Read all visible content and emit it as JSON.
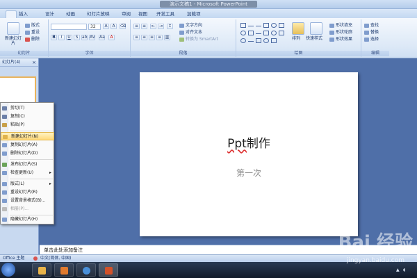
{
  "window": {
    "title": "演示文稿1 - Microsoft PowerPoint"
  },
  "ribbon": {
    "tabs": [
      "插入",
      "设计",
      "动画",
      "幻灯片放映",
      "审阅",
      "视图",
      "开发工具",
      "加载项"
    ],
    "slides_group": {
      "label": "幻灯片",
      "new_slide": "新建幻灯片",
      "layout": "版式",
      "reset": "重设",
      "delete": "删除"
    },
    "font_group": {
      "label": "字体",
      "font_size": "32"
    },
    "paragraph_group": {
      "label": "段落",
      "text_direction": "文字方向",
      "align_text": "对齐文本",
      "smartart": "转换为 SmartArt"
    },
    "drawing_group": {
      "label": "绘图",
      "arrange": "排列",
      "quick_styles": "快速样式",
      "shape_fill": "形状填充",
      "shape_outline": "形状轮廓",
      "shape_effects": "形状效果"
    },
    "editing_group": {
      "label": "编辑",
      "find": "查找",
      "replace": "替换",
      "select": "选择"
    }
  },
  "panel": {
    "tab_label": "幻灯片(4)",
    "close": "×"
  },
  "context_menu": {
    "items": [
      {
        "label": "剪切(T)",
        "icon": "scissors-icon",
        "color": "#6b7fa8"
      },
      {
        "label": "复制(C)",
        "icon": "copy-icon",
        "color": "#6b7fa8"
      },
      {
        "label": "粘贴(P)",
        "icon": "paste-icon",
        "color": "#c8a04a"
      },
      {
        "label": "新建幻灯片(N)",
        "icon": "new-slide-icon",
        "color": "#e0b34c",
        "highlight": true
      },
      {
        "label": "复制幻灯片(A)",
        "icon": "duplicate-slide-icon",
        "color": "#7f9ccd"
      },
      {
        "label": "删除幻灯片(D)",
        "icon": "delete-slide-icon",
        "color": "#7f9ccd"
      },
      {
        "label": "发布幻灯片(S)",
        "icon": "publish-icon",
        "color": "#6aa35a"
      },
      {
        "label": "检查更新(U)",
        "icon": "update-icon",
        "color": "#7f9ccd",
        "submenu": true
      },
      {
        "label": "版式(L)",
        "icon": "layout-icon",
        "color": "#7f9ccd",
        "submenu": true
      },
      {
        "label": "重设幻灯片(R)",
        "icon": "reset-icon",
        "color": "#7f9ccd"
      },
      {
        "label": "设置背景格式(B)...",
        "icon": "background-icon",
        "color": "#7f9ccd"
      },
      {
        "label": "相册(P)...",
        "icon": "album-icon",
        "color": "#bbbbbb",
        "disabled": true
      },
      {
        "label": "隐藏幻灯片(H)",
        "icon": "hide-slide-icon",
        "color": "#7f9ccd"
      }
    ]
  },
  "slide": {
    "title_prefix": "Ppt",
    "title_suffix": "制作",
    "subtitle": "第一次"
  },
  "notes": {
    "placeholder": "单击此处添加备注"
  },
  "statusbar": {
    "theme": "Office 主题",
    "language": "中文(简体, 中国)"
  },
  "watermark": {
    "brand": "Bai 经验",
    "url": "jingyan.baidu.com"
  }
}
